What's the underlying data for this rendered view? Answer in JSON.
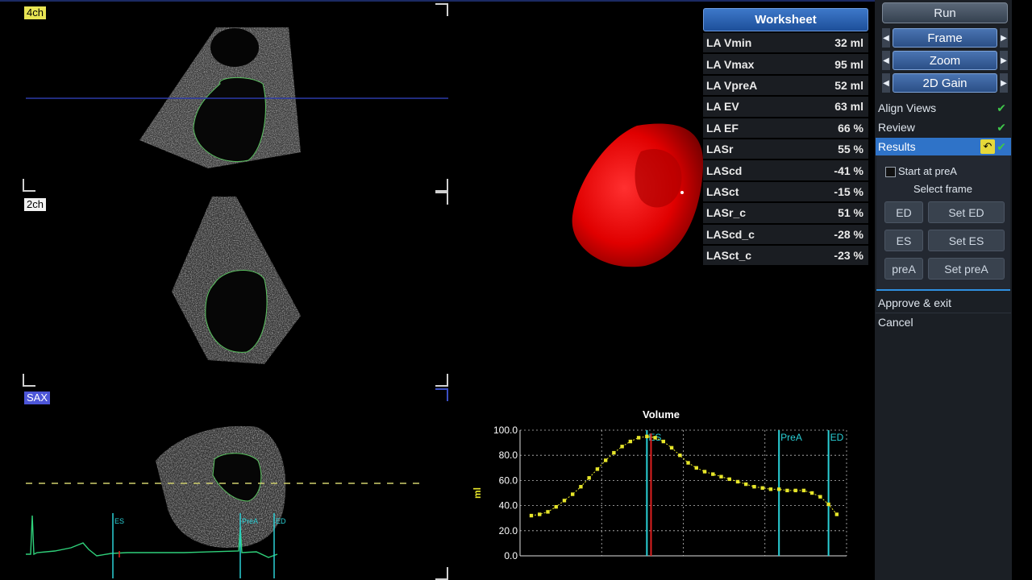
{
  "views": [
    {
      "label": "4ch"
    },
    {
      "label": "2ch"
    },
    {
      "label": "SAX"
    }
  ],
  "ecg_markers": [
    "ES",
    "PreA",
    "ED"
  ],
  "worksheet": {
    "title": "Worksheet",
    "rows": [
      {
        "label": "LA Vmin",
        "value": "32 ml"
      },
      {
        "label": "LA Vmax",
        "value": "95 ml"
      },
      {
        "label": "LA VpreA",
        "value": "52 ml"
      },
      {
        "label": "LA EV",
        "value": "63 ml"
      },
      {
        "label": "LA EF",
        "value": "66 %"
      },
      {
        "label": "LASr",
        "value": "55 %"
      },
      {
        "label": "LAScd",
        "value": "-41 %"
      },
      {
        "label": "LASct",
        "value": "-15 %"
      },
      {
        "label": "LASr_c",
        "value": "51 %"
      },
      {
        "label": "LAScd_c",
        "value": "-28 %"
      },
      {
        "label": "LASct_c",
        "value": "-23 %"
      }
    ]
  },
  "panel": {
    "run_label": "Run",
    "frame_label": "Frame",
    "zoom_label": "Zoom",
    "gain_label": "2D Gain",
    "steps": {
      "align_views": "Align Views",
      "review": "Review",
      "results": "Results"
    },
    "start_prea_label": "Start at preA",
    "select_frame_label": "Select frame",
    "ed_label": "ED",
    "set_ed_label": "Set ED",
    "es_label": "ES",
    "set_es_label": "Set ES",
    "prea_label": "preA",
    "set_prea_label": "Set preA",
    "approve_label": "Approve & exit",
    "cancel_label": "Cancel"
  },
  "icons": {
    "frame_prev": "arrow-left-icon",
    "frame_next": "arrow-right-icon",
    "undo": "undo-icon",
    "check": "check-icon"
  },
  "colors": {
    "worksheet_header": "#2a64b6",
    "results_highlight": "#2f73c8",
    "chart_points": "#e7e62a",
    "marker_lines": "#2ad0d6",
    "current_frame": "#e02020",
    "surface_model": "#ff1a1a"
  },
  "chart_data": {
    "type": "line",
    "title": "Volume",
    "xlabel": "",
    "ylabel": "ml",
    "ylim": [
      0,
      100
    ],
    "yticks": [
      "0.0",
      "20.0",
      "40.0",
      "60.0",
      "80.0",
      "100.0"
    ],
    "grid": true,
    "x": [
      0,
      1,
      2,
      3,
      4,
      5,
      6,
      7,
      8,
      9,
      10,
      11,
      12,
      13,
      14,
      15,
      16,
      17,
      18,
      19,
      20,
      21,
      22,
      23,
      24,
      25,
      26,
      27,
      28,
      29,
      30,
      31,
      32,
      33,
      34,
      35,
      36,
      37
    ],
    "values": [
      32,
      33,
      35,
      39,
      44,
      49,
      55,
      62,
      69,
      76,
      82,
      87,
      91,
      94,
      95,
      94,
      91,
      86,
      80,
      74,
      70,
      67,
      65,
      63,
      61,
      59,
      57,
      55,
      54,
      53,
      53,
      52,
      52,
      52,
      50,
      47,
      41,
      33
    ],
    "markers": [
      {
        "label": "ES",
        "x": 14
      },
      {
        "label": "PreA",
        "x": 30
      },
      {
        "label": "ED",
        "x": 36
      }
    ],
    "current_frame_x": 14.5
  }
}
